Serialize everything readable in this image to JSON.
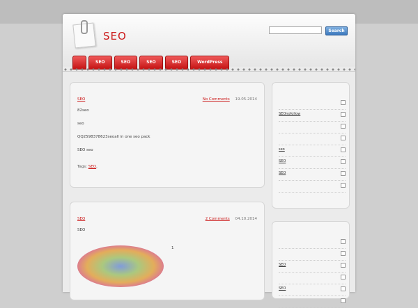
{
  "site": {
    "title": "SEO"
  },
  "search": {
    "button_label": "Search",
    "placeholder": ""
  },
  "nav": {
    "items": [
      "",
      "SEO",
      "SEO",
      "SEO",
      "SEO",
      "WordPress"
    ]
  },
  "posts": [
    {
      "title": "",
      "category": "SEO",
      "comments": "No Comments",
      "date": "19.05.2014",
      "body": [
        "82seo",
        "seo",
        "QQ2598378623seoall in one seo pack",
        "SEO seo"
      ],
      "tags_label": "Tags:",
      "tags": [
        "SEO",
        ""
      ]
    },
    {
      "title": "",
      "category": "SEO",
      "comments": "2 Comments",
      "date": "04.10.2014",
      "body": [
        "SEO",
        "",
        "1"
      ]
    }
  ],
  "widgets": [
    {
      "title": "",
      "items": [
        "",
        "SEOnofollow",
        "",
        "",
        "seo",
        "SEO",
        "SEO",
        ""
      ]
    },
    {
      "title": "",
      "items": [
        "",
        "",
        "SEO",
        "",
        "SEO",
        ""
      ]
    }
  ],
  "colors": {
    "accent": "#cc1a1a",
    "search_button": "#3c78bd"
  }
}
